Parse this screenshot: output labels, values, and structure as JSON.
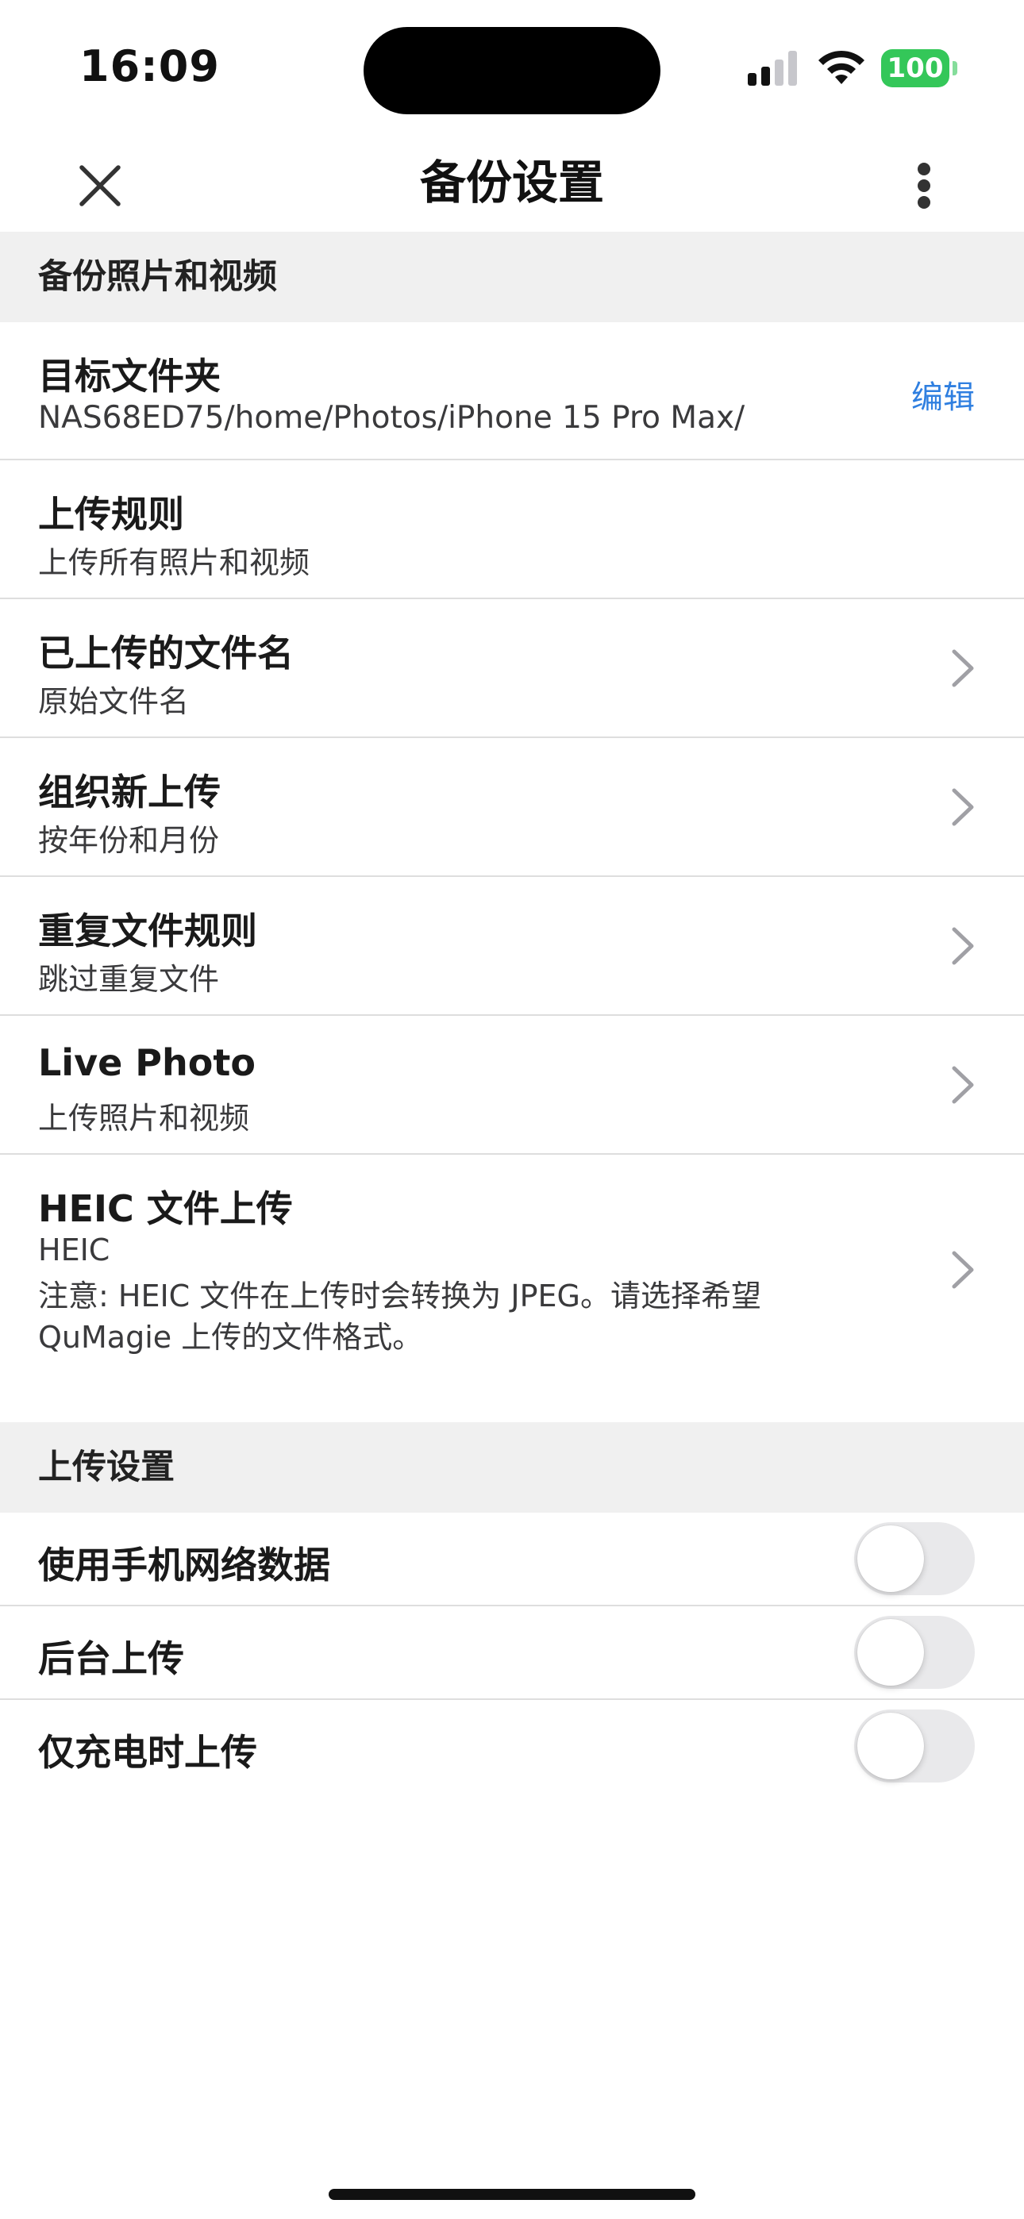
{
  "status_bar": {
    "time": "16:09",
    "battery": "100",
    "battery_color": "#34c759"
  },
  "nav": {
    "title": "备份设置",
    "close_icon": "close-icon",
    "more_icon": "more-vertical-icon"
  },
  "sections": {
    "backup": {
      "header": "备份照片和视频",
      "target_folder": {
        "title": "目标文件夹",
        "value": "NAS68ED75/home/Photos/iPhone 15 Pro Max/",
        "action": "编辑"
      },
      "upload_rule": {
        "title": "上传规则",
        "value": "上传所有照片和视频"
      },
      "uploaded_filename": {
        "title": "已上传的文件名",
        "value": "原始文件名"
      },
      "organize_uploads": {
        "title": "组织新上传",
        "value": "按年份和月份"
      },
      "duplicate_rule": {
        "title": "重复文件规则",
        "value": "跳过重复文件"
      },
      "live_photo": {
        "title": "Live Photo",
        "value": "上传照片和视频"
      },
      "heic_upload": {
        "title": "HEIC 文件上传",
        "value": "HEIC",
        "note": "注意: HEIC 文件在上传时会转换为 JPEG。请选择希望 QuMagie 上传的文件格式。"
      }
    },
    "upload": {
      "header": "上传设置",
      "use_cellular": {
        "label": "使用手机网络数据",
        "enabled": false
      },
      "background_upload": {
        "label": "后台上传",
        "enabled": false
      },
      "charging_only": {
        "label": "仅充电时上传",
        "enabled": false
      }
    }
  },
  "colors": {
    "accent": "#2f7fe0",
    "section_bg": "#f0f0f0",
    "toggle_off": "#e9e9eb"
  }
}
